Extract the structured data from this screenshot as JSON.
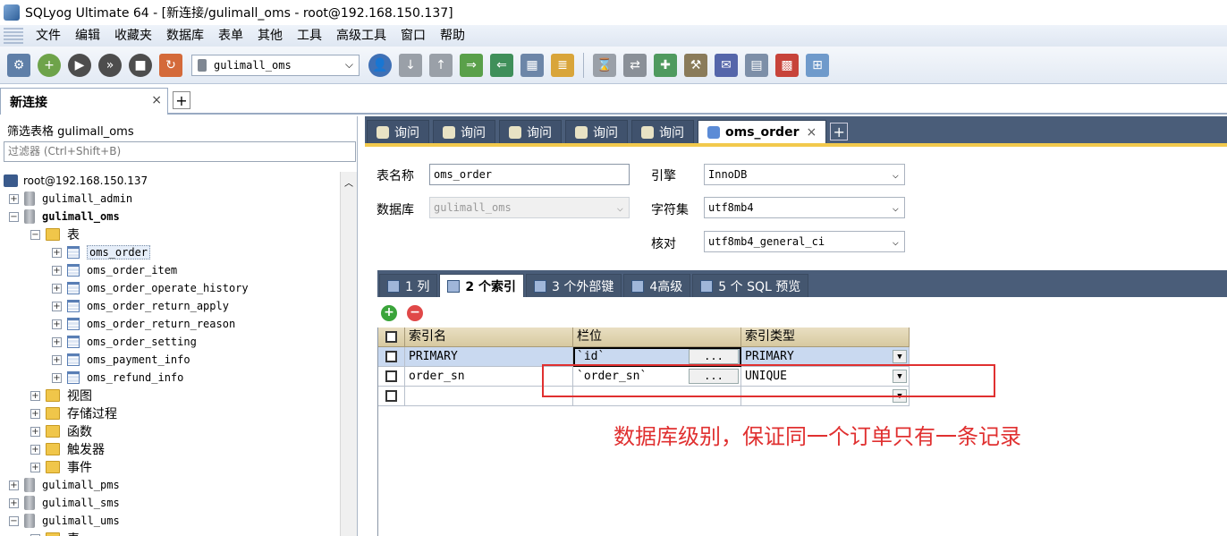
{
  "window": {
    "title": "SQLyog Ultimate 64 - [新连接/gulimall_oms - root@192.168.150.137]"
  },
  "menu": [
    "文件",
    "编辑",
    "收藏夹",
    "数据库",
    "表单",
    "其他",
    "工具",
    "高级工具",
    "窗口",
    "帮助"
  ],
  "toolbar": {
    "database_select": "gulimall_oms",
    "icons": [
      "new-connection-icon",
      "new-query-icon",
      "execute-icon",
      "execute-all-icon",
      "stop-icon",
      "refresh-icon",
      "user-icon",
      "backup-icon",
      "restore-icon",
      "import-icon",
      "export-icon",
      "schema-icon",
      "data-sync-icon",
      "schedule-icon",
      "sync-icon",
      "query-builder-icon",
      "designer-icon",
      "notify-icon",
      "report-icon",
      "visual-icon"
    ]
  },
  "connection_tab": {
    "label": "新连接",
    "close": "×",
    "add": "+"
  },
  "left": {
    "filter_label": "筛选表格 gulimall_oms",
    "filter_placeholder": "过滤器 (Ctrl+Shift+B)",
    "tree": {
      "server": "root@192.168.150.137",
      "db_admin": "gulimall_admin",
      "db_oms": "gulimall_oms",
      "folder_tables": "表",
      "tables": [
        "oms_order",
        "oms_order_item",
        "oms_order_operate_history",
        "oms_order_return_apply",
        "oms_order_return_reason",
        "oms_order_setting",
        "oms_payment_info",
        "oms_refund_info"
      ],
      "folder_views": "视图",
      "folder_procs": "存储过程",
      "folder_funcs": "函数",
      "folder_triggers": "触发器",
      "folder_events": "事件",
      "db_pms": "gulimall_pms",
      "db_sms": "gulimall_sms",
      "db_ums": "gulimall_ums",
      "folder_last": "表"
    }
  },
  "query_tabs": {
    "query_label": "询问",
    "active": "oms_order",
    "close": "×",
    "add": "+"
  },
  "form": {
    "table_name_label": "表名称",
    "table_name_value": "oms_order",
    "database_label": "数据库",
    "database_value": "gulimall_oms",
    "engine_label": "引擎",
    "engine_value": "InnoDB",
    "charset_label": "字符集",
    "charset_value": "utf8mb4",
    "collation_label": "核对",
    "collation_value": "utf8mb4_general_ci"
  },
  "sub_tabs": [
    "1 列",
    "2 个索引",
    "3 个外部键",
    "4高级",
    "5 个 SQL 预览"
  ],
  "index_grid": {
    "headers": [
      "索引名",
      "栏位",
      "索引类型"
    ],
    "rows": [
      {
        "name": "PRIMARY",
        "column": "`id`",
        "type": "PRIMARY"
      },
      {
        "name": "order_sn",
        "column": "`order_sn`",
        "type": "UNIQUE"
      },
      {
        "name": "",
        "column": "",
        "type": ""
      }
    ],
    "dots": "...",
    "add": "+",
    "remove": "−"
  },
  "annotation": "数据库级别，保证同一个订单只有一条记录"
}
